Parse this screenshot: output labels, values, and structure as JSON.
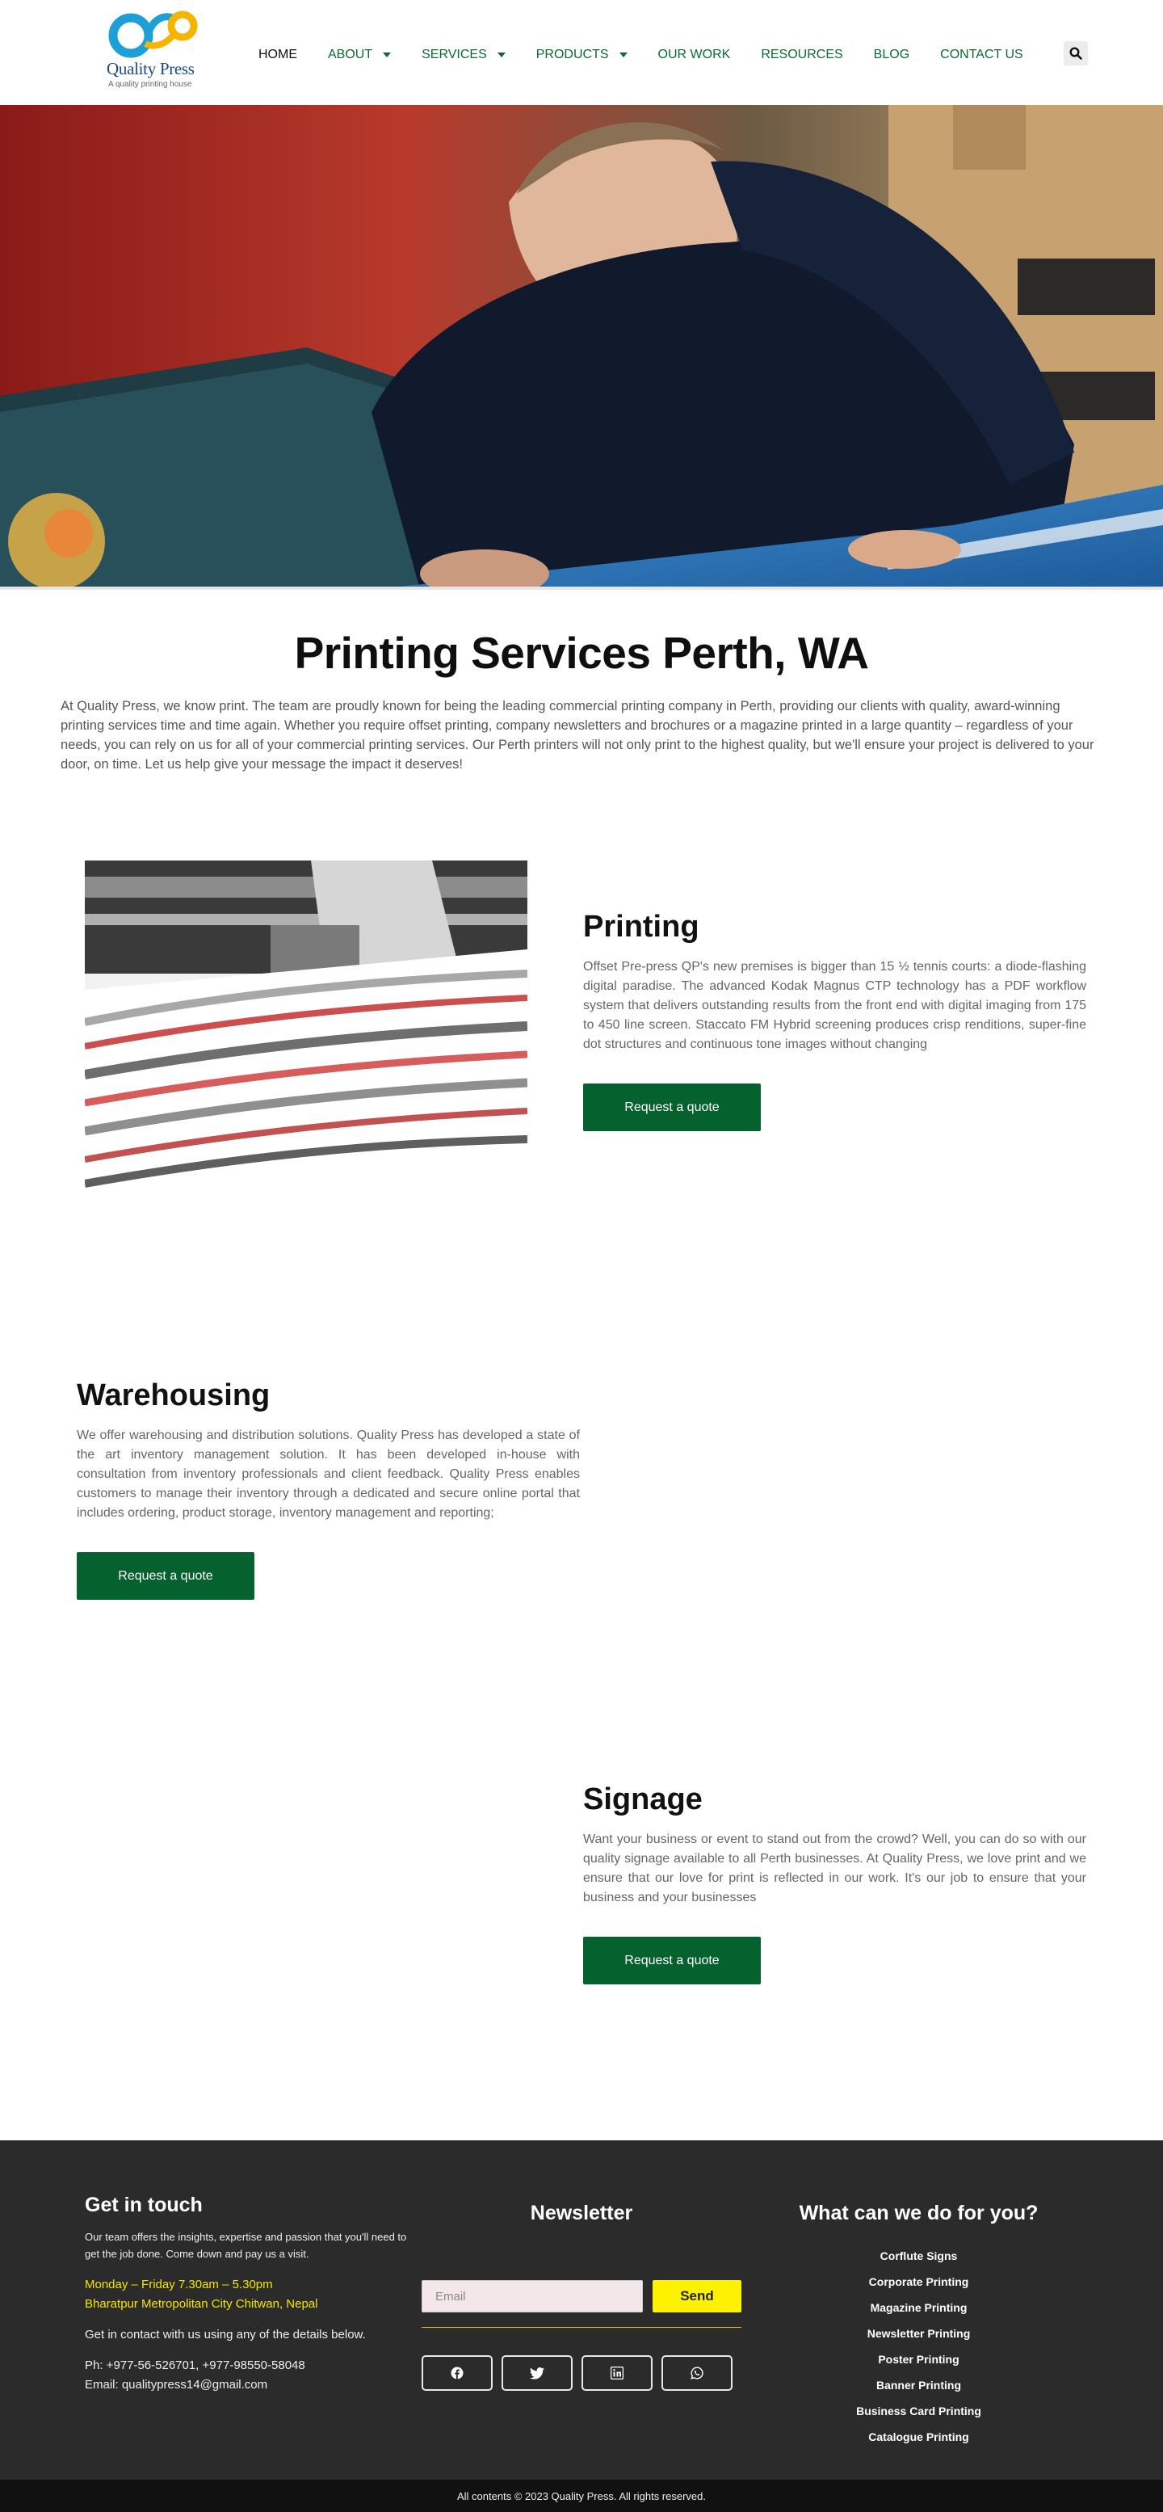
{
  "brand": {
    "name": "Quality Press",
    "tagline": "A quality printing house",
    "primary_color": "#05622f",
    "accent_yellow": "#fff200"
  },
  "nav": {
    "items": [
      {
        "label": "HOME",
        "active": true,
        "dropdown": false
      },
      {
        "label": "ABOUT",
        "active": false,
        "dropdown": true
      },
      {
        "label": "SERVICES",
        "active": false,
        "dropdown": true
      },
      {
        "label": "PRODUCTS",
        "active": false,
        "dropdown": true
      },
      {
        "label": "OUR WORK",
        "active": false,
        "dropdown": false
      },
      {
        "label": "RESOURCES",
        "active": false,
        "dropdown": false
      },
      {
        "label": "BLOG",
        "active": false,
        "dropdown": false
      },
      {
        "label": "CONTACT US",
        "active": false,
        "dropdown": false
      }
    ],
    "search_icon": "search-icon"
  },
  "intro": {
    "title": "Printing Services Perth, WA",
    "text": "At Quality Press, we know print. The team are proudly known for being the leading commercial printing company in Perth, providing our clients with quality, award-winning printing services time and time again. Whether you require offset printing, company newsletters and brochures or a magazine printed in a large quantity – regardless of your needs, you can rely on us for all of your commercial printing services. Our Perth printers will not only print to the highest quality, but we'll ensure your project is delivered to your door, on time. Let us help give your message the impact it deserves!"
  },
  "printing": {
    "title": "Printing",
    "text": "Offset Pre-press QP's new premises is bigger than 15 ½ tennis courts: a diode-flashing digital paradise. The advanced Kodak Magnus CTP technology has a PDF workflow system that delivers outstanding results from the front end with digital imaging from 175 to 450 line screen. Staccato FM Hybrid screening produces crisp renditions, super-fine dot structures and continuous tone images without changing",
    "button": "Request a quote"
  },
  "warehousing": {
    "title": "Warehousing",
    "text": "We offer warehousing and distribution solutions. Quality Press has developed a state of the art inventory management solution. It has been developed in-house with consultation from inventory professionals and client feedback. Quality Press enables customers to manage their inventory through a dedicated and secure online portal that includes ordering, product storage, inventory management and reporting;",
    "button": "Request a quote"
  },
  "signage": {
    "title": "Signage",
    "text": "Want your business or event to stand out from the crowd? Well, you can do so with our quality signage available to all Perth businesses. At Quality Press, we love print and we ensure that our love for print is reflected in our work. It's our job to ensure that your business and your businesses",
    "button": "Request a quote"
  },
  "footer": {
    "contact": {
      "heading": "Get in touch",
      "blurb": "Our team offers the insights, expertise and passion that you'll need to get the job done. Come down and pay us a visit.",
      "hours": "Monday – Friday 7.30am – 5.30pm",
      "address": "Bharatpur Metropolitan City Chitwan, Nepal",
      "cta": "Get in contact with us using any of the details below.",
      "phone": "Ph: +977-56-526701, +977-98550-58048",
      "email": "Email: qualitypress14@gmail.com"
    },
    "newsletter": {
      "heading": "Newsletter",
      "email_placeholder": "Email",
      "send_label": "Send",
      "socials": [
        "facebook-icon",
        "twitter-icon",
        "linkedin-icon",
        "whatsapp-icon"
      ]
    },
    "services": {
      "heading": "What can we do for you?",
      "items": [
        "Corflute Signs",
        "Corporate Printing",
        "Magazine Printing",
        "Newsletter Printing",
        "Poster Printing",
        "Banner Printing",
        "Business Card Printing",
        "Catalogue Printing"
      ]
    },
    "copyright": "All contents © 2023 Quality Press. All rights reserved."
  }
}
